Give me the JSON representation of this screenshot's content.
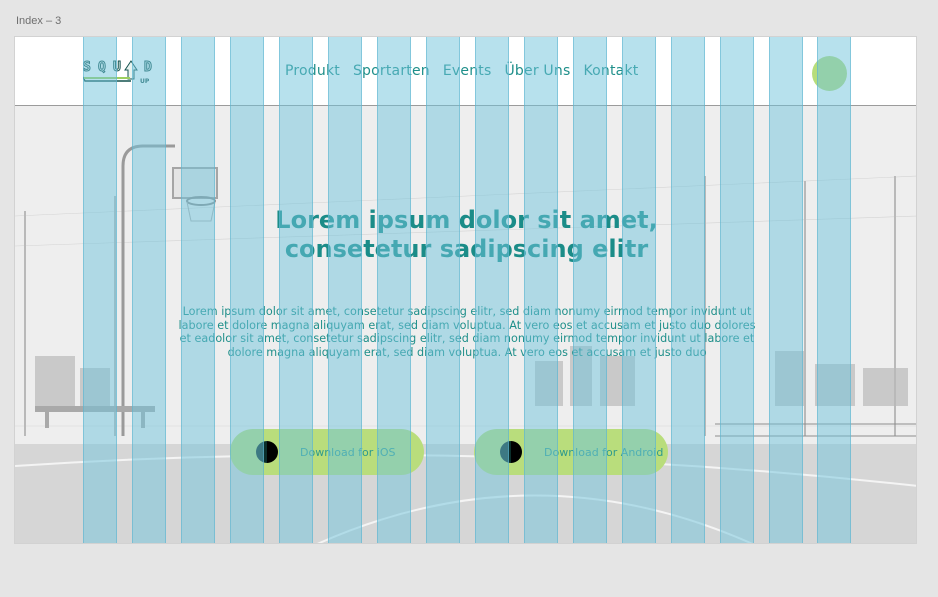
{
  "canvas": {
    "frame_label": "Index – 3"
  },
  "header": {
    "logo_letters": [
      "S",
      "Q",
      "U",
      "D"
    ],
    "logo_up": "UP",
    "nav": [
      "Produkt",
      "Sportarten",
      "Events",
      "Über Uns",
      "Kontakt"
    ]
  },
  "hero": {
    "title_line1": "Lorem ipsum dolor sit amet,",
    "title_line2": "consetetur sadipscing elitr",
    "body": "Lorem ipsum dolor sit amet, consetetur sadipscing elitr, sed diam nonumy eirmod tempor invidunt ut labore et dolore magna aliquyam erat, sed diam voluptua. At vero eos et accusam et justo duo dolores et eadolor sit amet, consetetur sadipscing elitr, sed diam nonumy eirmod tempor invidunt ut labore et dolore magna aliquyam erat, sed diam voluptua. At vero eos et accusam et justo duo",
    "buttons": {
      "ios": "Download for iOS",
      "android": "Download for Android"
    }
  },
  "colors": {
    "brand_teal": "#1b8c88",
    "button_green": "#b9dd7c",
    "grid_column": "#70c4db"
  }
}
